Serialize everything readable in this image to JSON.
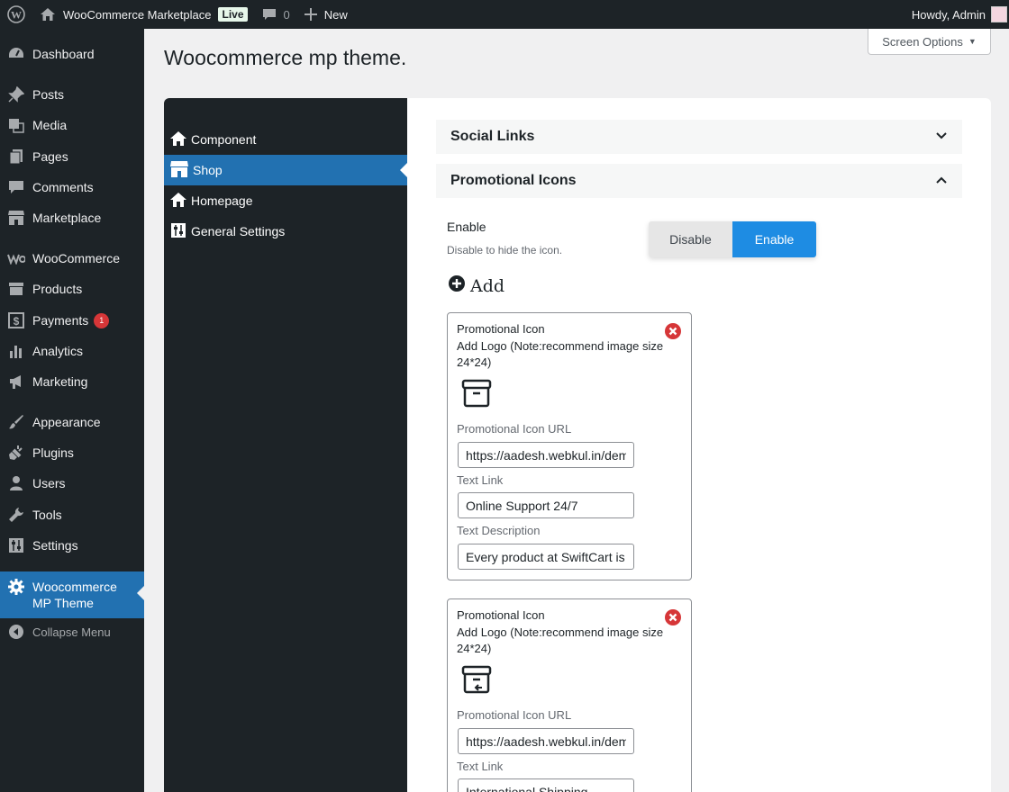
{
  "adminbar": {
    "site_name": "WooCommerce Marketplace",
    "live_badge": "Live",
    "comment_count": "0",
    "new_label": "New",
    "howdy": "Howdy, Admin"
  },
  "sidebar": {
    "items": [
      {
        "label": "Dashboard",
        "icon": "dashboard-icon"
      },
      {
        "label": "Posts",
        "icon": "pin-icon"
      },
      {
        "label": "Media",
        "icon": "media-icon"
      },
      {
        "label": "Pages",
        "icon": "pages-icon"
      },
      {
        "label": "Comments",
        "icon": "comment-icon"
      },
      {
        "label": "Marketplace",
        "icon": "store-icon"
      },
      {
        "label": "WooCommerce",
        "icon": "woo-icon"
      },
      {
        "label": "Products",
        "icon": "archive-icon"
      },
      {
        "label": "Payments",
        "icon": "dollar-icon",
        "badge": "1"
      },
      {
        "label": "Analytics",
        "icon": "bar-chart-icon"
      },
      {
        "label": "Marketing",
        "icon": "megaphone-icon"
      },
      {
        "label": "Appearance",
        "icon": "brush-icon"
      },
      {
        "label": "Plugins",
        "icon": "plug-icon"
      },
      {
        "label": "Users",
        "icon": "user-icon"
      },
      {
        "label": "Tools",
        "icon": "wrench-icon"
      },
      {
        "label": "Settings",
        "icon": "sliders-icon"
      }
    ],
    "active_line1": "Woocommerce",
    "active_line2": "MP Theme",
    "collapse": "Collapse Menu"
  },
  "screen_options": "Screen Options",
  "page_title": "Woocommerce mp theme.",
  "subnav": {
    "items": [
      "Component",
      "Shop",
      "Homepage",
      "General Settings"
    ],
    "active": "Shop"
  },
  "accordions": {
    "social": "Social Links",
    "promo": "Promotional Icons"
  },
  "enable": {
    "label": "Enable",
    "help": "Disable to hide the icon.",
    "disable_btn": "Disable",
    "enable_btn": "Enable"
  },
  "add_label": "Add",
  "cards": [
    {
      "title": "Promotional Icon",
      "logo_label": "Add Logo (Note:recommend image size 24*24)",
      "url_label": "Promotional Icon URL",
      "url_value": "https://aadesh.webkul.in/demo",
      "text_label": "Text Link",
      "text_value": "Online Support 24/7",
      "desc_label": "Text Description",
      "desc_value": "Every product at SwiftCart is"
    },
    {
      "title": "Promotional Icon",
      "logo_label": "Add Logo (Note:recommend image size 24*24)",
      "url_label": "Promotional Icon URL",
      "url_value": "https://aadesh.webkul.in/demo",
      "text_label": "Text Link",
      "text_value": "International Shipping"
    }
  ]
}
